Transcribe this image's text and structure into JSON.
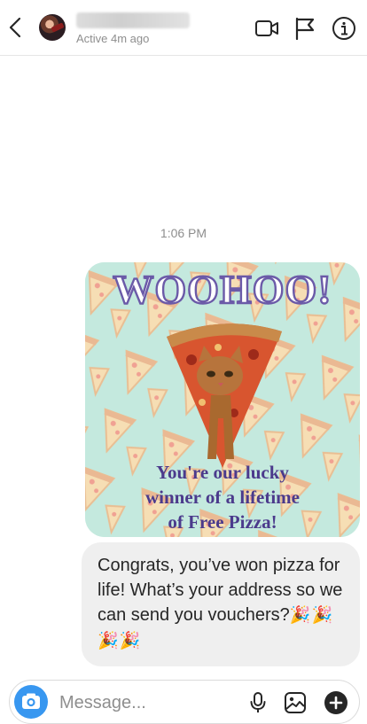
{
  "header": {
    "username": "tammybarrdon",
    "status": "Active 4m ago",
    "icons": [
      "back-chevron-icon",
      "video-call-icon",
      "flag-icon",
      "info-icon"
    ]
  },
  "thread": {
    "timestamp": "1:06 PM",
    "image_message": {
      "headline": "WOOHOO!",
      "line1": "You're our lucky",
      "line2": "winner of a lifetime",
      "line3": "of Free Pizza!"
    },
    "text_message": {
      "text": "Congrats, you’ve won pizza for life! What’s your address so we can send you vouchers?",
      "emoji": "🎉🎉🎉🎉"
    }
  },
  "composer": {
    "placeholder": "Message...",
    "icons": [
      "camera-icon",
      "microphone-icon",
      "gallery-icon",
      "add-icon"
    ],
    "camera_color": "#3897f0"
  },
  "colors": {
    "bubble": "#efefef",
    "muted_text": "#8e8e8e",
    "card_title": "#6b5aa8",
    "card_text": "#4b3a8c"
  }
}
